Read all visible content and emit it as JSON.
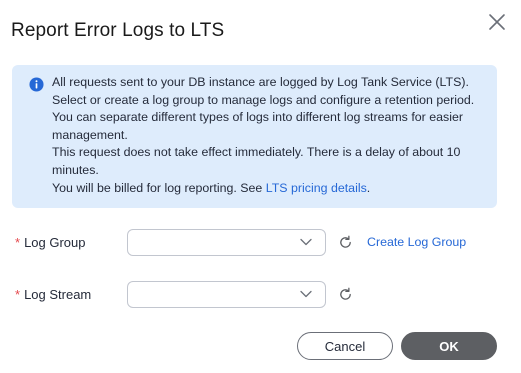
{
  "dialog": {
    "title": "Report Error Logs to LTS"
  },
  "info": {
    "lines": [
      "All requests sent to your DB instance are logged by Log Tank Service (LTS).",
      "Select or create a log group to manage logs and configure a retention period.",
      "You can separate different types of logs into different log streams for easier management.",
      "This request does not take effect immediately. There is a delay of about 10 minutes."
    ],
    "billing_text": "You will be billed for log reporting. See ",
    "billing_link": "LTS pricing details",
    "billing_suffix": "."
  },
  "form": {
    "required_mark": "*",
    "log_group": {
      "label": "Log Group",
      "value": "",
      "create_link": "Create Log Group"
    },
    "log_stream": {
      "label": "Log Stream",
      "value": ""
    }
  },
  "footer": {
    "cancel_label": "Cancel",
    "ok_label": "OK"
  },
  "colors": {
    "info_bg": "#deecfc",
    "link": "#2668d6",
    "info_icon": "#2668d6",
    "required": "#e5484d",
    "ok_button": "#5d5f63"
  },
  "icons": {
    "close": "close-icon",
    "info": "info-icon",
    "chevron": "chevron-down-icon",
    "refresh": "refresh-icon"
  }
}
